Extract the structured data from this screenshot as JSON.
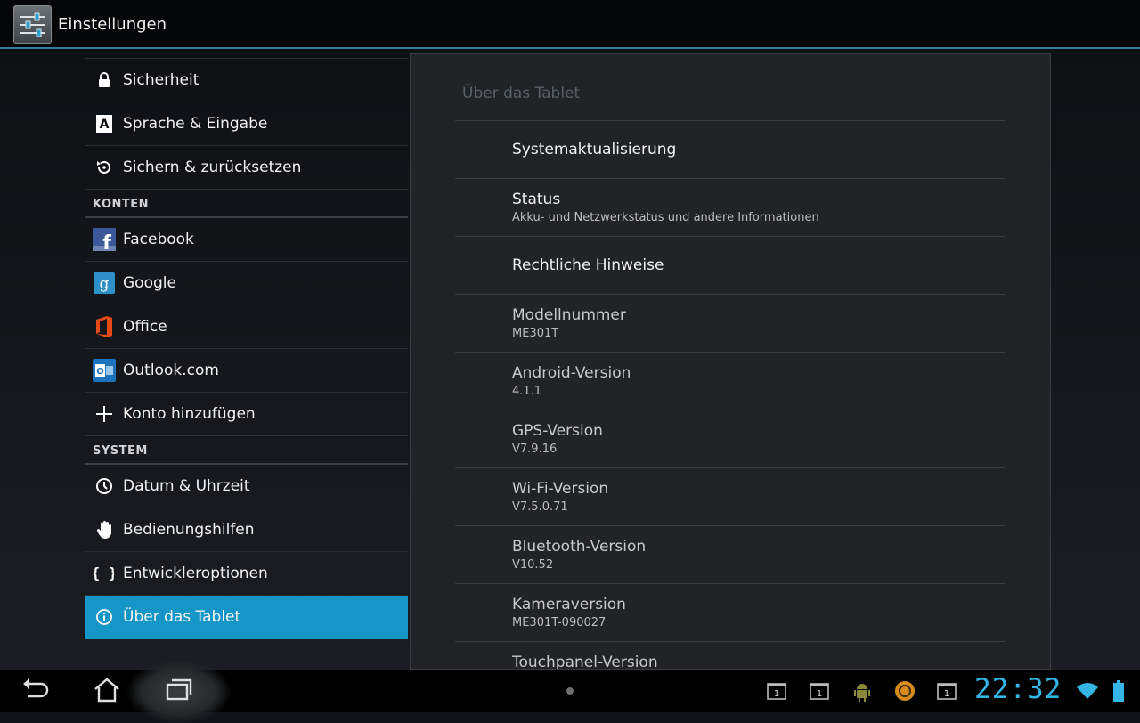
{
  "app": {
    "title": "Einstellungen",
    "icon": "settings-sliders-icon"
  },
  "sidebar": {
    "items_top": [
      {
        "label": "Sicherheit",
        "icon": "lock-icon"
      },
      {
        "label": "Sprache & Eingabe",
        "icon": "keyboard-a-icon"
      },
      {
        "label": "Sichern & zurücksetzen",
        "icon": "restore-icon"
      }
    ],
    "section_accounts": "KONTEN",
    "items_accounts": [
      {
        "label": "Facebook",
        "icon": "facebook-icon"
      },
      {
        "label": "Google",
        "icon": "google-icon"
      },
      {
        "label": "Office",
        "icon": "office-icon"
      },
      {
        "label": "Outlook.com",
        "icon": "outlook-icon"
      },
      {
        "label": "Konto hinzufügen",
        "icon": "plus-icon"
      }
    ],
    "section_system": "SYSTEM",
    "items_system": [
      {
        "label": "Datum & Uhrzeit",
        "icon": "clock-icon"
      },
      {
        "label": "Bedienungshilfen",
        "icon": "hand-icon"
      },
      {
        "label": "Entwickleroptionen",
        "icon": "braces-icon"
      },
      {
        "label": "Über das Tablet",
        "icon": "info-icon",
        "selected": true
      }
    ]
  },
  "panel": {
    "title": "Über das Tablet",
    "rows": [
      {
        "title": "Systemaktualisierung",
        "subtitle": ""
      },
      {
        "title": "Status",
        "subtitle": "Akku- und Netzwerkstatus und andere Informationen"
      },
      {
        "title": "Rechtliche Hinweise",
        "subtitle": ""
      },
      {
        "title": "Modellnummer",
        "subtitle": "ME301T"
      },
      {
        "title": "Android-Version",
        "subtitle": "4.1.1"
      },
      {
        "title": "GPS-Version",
        "subtitle": "V7.9.16"
      },
      {
        "title": "Wi-Fi-Version",
        "subtitle": "V7.5.0.71"
      },
      {
        "title": "Bluetooth-Version",
        "subtitle": "V10.52"
      },
      {
        "title": "Kameraversion",
        "subtitle": "ME301T-090027"
      },
      {
        "title": "Touchpanel-Version",
        "subtitle": ""
      }
    ]
  },
  "navbar": {
    "clock": "22:32",
    "notifications": [
      "calendar-1-icon",
      "calendar-1-icon",
      "android-icon",
      "sync-icon",
      "calendar-1-icon"
    ],
    "accent": "#33b5e5"
  },
  "colors": {
    "accent": "#1696c6",
    "clock": "#33b5e5"
  }
}
